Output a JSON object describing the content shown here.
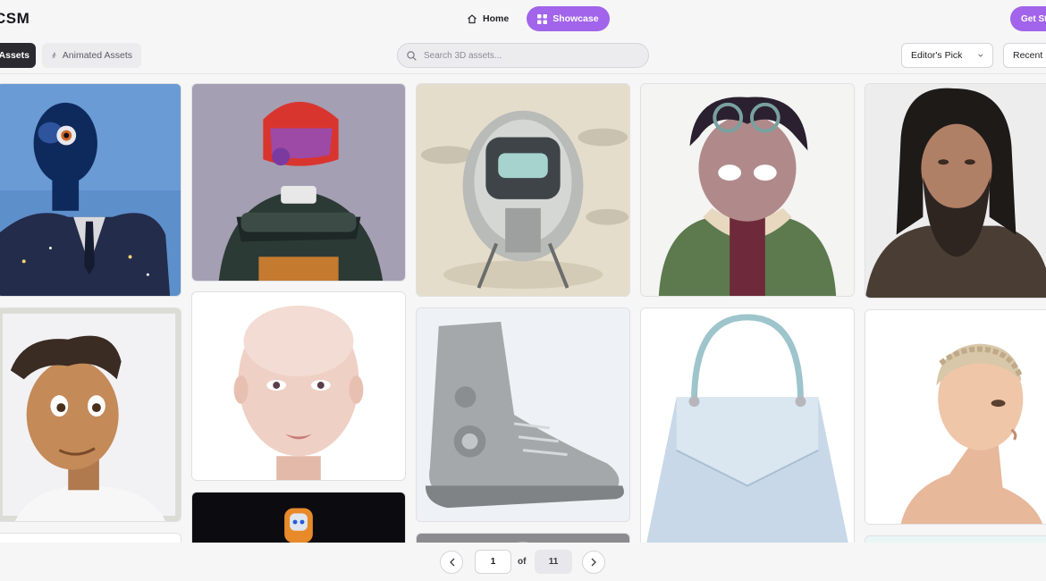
{
  "app": {
    "logo_text": "CSM"
  },
  "nav": {
    "home_label": "Home",
    "showcase_label": "Showcase",
    "get_started_label": "Get St"
  },
  "filters": {
    "assets_label": "Assets",
    "animated_label": "Animated Assets"
  },
  "search": {
    "placeholder": "Search 3D assets..."
  },
  "sort": {
    "editors_pick_label": "Editor's Pick",
    "recent_label": "Recent"
  },
  "pagination": {
    "current_page": "1",
    "of_label": "of",
    "total_pages": "11"
  },
  "icons": {
    "home": "home-icon",
    "showcase": "grid-icon",
    "animated": "running-figure-icon",
    "search": "search-icon",
    "dropdown": "chevron-down-icon",
    "prev": "chevron-left-icon",
    "next": "chevron-right-icon"
  },
  "colors": {
    "accent": "#a164ea",
    "dark_chip": "#2a2a30",
    "page_bg": "#f6f6f7"
  }
}
